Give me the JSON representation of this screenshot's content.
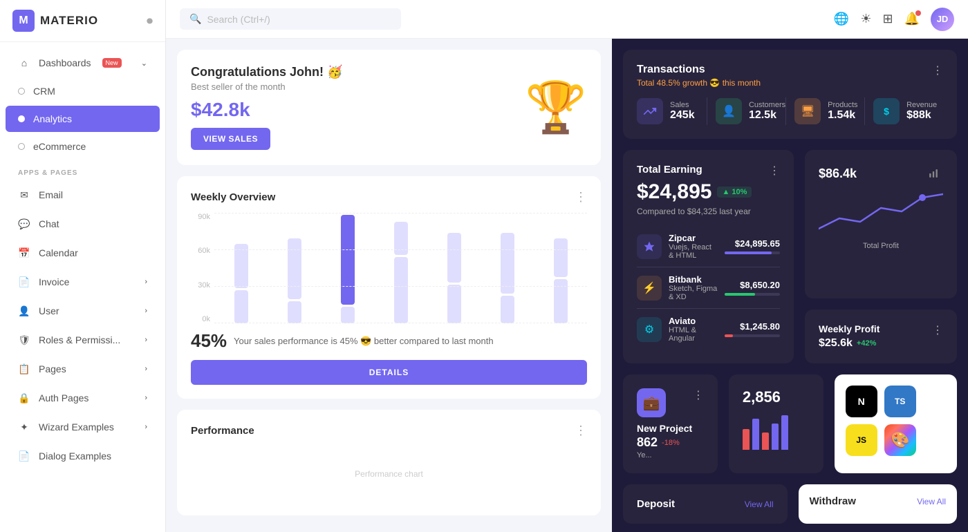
{
  "sidebar": {
    "logo": "M",
    "app_name": "MATERIO",
    "nav": [
      {
        "id": "dashboards",
        "label": "Dashboards",
        "icon": "⌂",
        "badge": "New",
        "has_chevron": true
      },
      {
        "id": "crm",
        "label": "CRM",
        "icon": "○"
      },
      {
        "id": "analytics",
        "label": "Analytics",
        "icon": "○",
        "active": true
      },
      {
        "id": "ecommerce",
        "label": "eCommerce",
        "icon": "○"
      }
    ],
    "section_title": "APPS & PAGES",
    "apps": [
      {
        "id": "email",
        "label": "Email",
        "icon": "✉"
      },
      {
        "id": "chat",
        "label": "Chat",
        "icon": "□"
      },
      {
        "id": "calendar",
        "label": "Calendar",
        "icon": "📅"
      },
      {
        "id": "invoice",
        "label": "Invoice",
        "icon": "📄",
        "has_chevron": true
      },
      {
        "id": "user",
        "label": "User",
        "icon": "👤",
        "has_chevron": true
      },
      {
        "id": "roles",
        "label": "Roles & Permissi...",
        "icon": "🛡",
        "has_chevron": true
      },
      {
        "id": "pages",
        "label": "Pages",
        "icon": "📋",
        "has_chevron": true
      },
      {
        "id": "auth",
        "label": "Auth Pages",
        "icon": "🔒",
        "has_chevron": true
      },
      {
        "id": "wizard",
        "label": "Wizard Examples",
        "icon": "✦",
        "has_chevron": true
      },
      {
        "id": "dialog",
        "label": "Dialog Examples",
        "icon": "📄"
      }
    ]
  },
  "header": {
    "search_placeholder": "Search (Ctrl+/)",
    "icons": [
      "translate",
      "brightness",
      "grid",
      "bell"
    ],
    "avatar_initials": "JD"
  },
  "congrats": {
    "title": "Congratulations John! 🥳",
    "subtitle": "Best seller of the month",
    "amount": "$42.8k",
    "button": "VIEW SALES",
    "trophy": "🏆"
  },
  "weekly": {
    "title": "Weekly Overview",
    "bars": [
      {
        "height_a": 40,
        "height_b": 30
      },
      {
        "height_a": 55,
        "height_b": 20
      },
      {
        "height_a": 100,
        "height_b": 15
      },
      {
        "height_a": 30,
        "height_b": 60
      },
      {
        "height_a": 45,
        "height_b": 35
      },
      {
        "height_a": 55,
        "height_b": 25
      },
      {
        "height_a": 35,
        "height_b": 40
      }
    ],
    "y_labels": [
      "90k",
      "60k",
      "30k",
      "0k"
    ],
    "percentage": "45%",
    "description": "Your sales performance is 45% 😎 better compared to last month",
    "button": "DETAILS"
  },
  "transactions": {
    "title": "Transactions",
    "subtitle_prefix": "Total 48.5% growth",
    "subtitle_emoji": "😎",
    "subtitle_suffix": "this month",
    "stats": [
      {
        "label": "Sales",
        "value": "245k",
        "icon": "📈",
        "bg": "#7367f022",
        "icon_bg": "#7367f0"
      },
      {
        "label": "Customers",
        "value": "12.5k",
        "icon": "👤",
        "bg": "#28c76f22",
        "icon_bg": "#28c76f"
      },
      {
        "label": "Products",
        "value": "1.54k",
        "icon": "🖥",
        "bg": "#ff9f4322",
        "icon_bg": "#ff9f43"
      },
      {
        "label": "Revenue",
        "value": "$88k",
        "icon": "$",
        "bg": "#00cfe822",
        "icon_bg": "#00cfe8"
      }
    ]
  },
  "total_earning": {
    "title": "Total Earning",
    "amount": "$24,895",
    "growth": "10%",
    "comparison": "Compared to $84,325 last year",
    "items": [
      {
        "name": "Zipcar",
        "sub": "Vuejs, React & HTML",
        "amount": "$24,895.65",
        "progress": 85,
        "color": "#7367f0",
        "icon": "💎",
        "icon_bg": "#7367f022"
      },
      {
        "name": "Bitbank",
        "sub": "Sketch, Figma & XD",
        "amount": "$8,650.20",
        "progress": 55,
        "color": "#28c76f",
        "icon": "⚡",
        "icon_bg": "#ff9f4322"
      },
      {
        "name": "Aviato",
        "sub": "HTML & Angular",
        "amount": "$1,245.80",
        "progress": 15,
        "color": "#ea5455",
        "icon": "⚙",
        "icon_bg": "#00cfe822"
      }
    ]
  },
  "total_profit": {
    "label": "Total Profit",
    "value": "$86.4k",
    "profit_label": "Total Profit",
    "weekly_label": "Weekly Profit",
    "weekly_value": "$25.6k",
    "weekly_growth": "+42%"
  },
  "new_project": {
    "title": "New Project",
    "count": "862",
    "growth": "-18%",
    "label": "Ye..."
  },
  "mini_stat": {
    "value": "2,856"
  },
  "tech_stack": {
    "items": [
      {
        "name": "Next.js",
        "bg": "#000",
        "label": "N"
      },
      {
        "name": "TypeScript",
        "bg": "#3178c6",
        "label": "TS"
      },
      {
        "name": "JavaScript",
        "bg": "#f7df1e",
        "label": "JS",
        "color": "#000"
      },
      {
        "name": "Figma",
        "bg": "linear-gradient(135deg, #f24e1e, #ff7262, #a259ff, #1abcfe, #0acf83)",
        "label": "🎨"
      }
    ]
  },
  "performance": {
    "title": "Performance"
  },
  "deposit": {
    "title": "Deposit",
    "view_all": "View All"
  },
  "withdraw": {
    "title": "Withdraw",
    "view_all": "View All"
  }
}
